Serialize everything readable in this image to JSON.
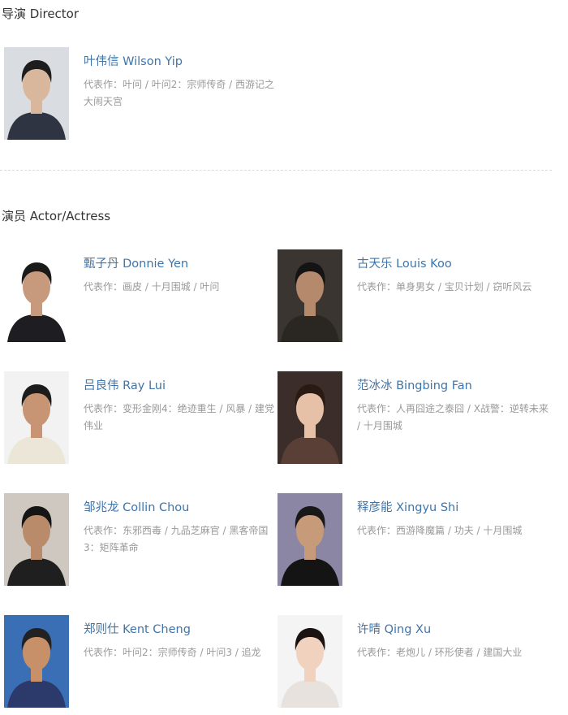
{
  "director_section": {
    "title": "导演 Director",
    "people": [
      {
        "name": "叶伟信 Wilson Yip",
        "label": "代表作：",
        "works": "叶问 / 叶问2：宗师传奇 / 西游记之大闹天宫",
        "photo": {
          "bg": "#d9dde2",
          "face": "#d8b79c",
          "hair": "#1d1d1d",
          "cloth": "#2e3442"
        }
      }
    ]
  },
  "actor_section": {
    "title": "演员 Actor/Actress",
    "people": [
      {
        "name": "甄子丹 Donnie Yen",
        "label": "代表作：",
        "works": "画皮 / 十月围城 / 叶问",
        "photo": {
          "bg": "#ffffff",
          "face": "#c89a7d",
          "hair": "#1a1a1a",
          "cloth": "#1e1e22"
        }
      },
      {
        "name": "古天乐 Louis Koo",
        "label": "代表作：",
        "works": "单身男女 / 宝贝计划 / 窃听风云",
        "photo": {
          "bg": "#3a3530",
          "face": "#b58a6c",
          "hair": "#141414",
          "cloth": "#2a2622"
        }
      },
      {
        "name": "吕良伟 Ray Lui",
        "label": "代表作：",
        "works": "变形金刚4：绝迹重生 / 风暴 / 建党伟业",
        "photo": {
          "bg": "#f2f2f2",
          "face": "#c79474",
          "hair": "#1c1c1c",
          "cloth": "#ece6d8"
        }
      },
      {
        "name": "范冰冰 Bingbing Fan",
        "label": "代表作：",
        "works": "人再囧途之泰囧 / X战警：逆转未来 / 十月围城",
        "photo": {
          "bg": "#3b2e2a",
          "face": "#e6c1a8",
          "hair": "#2a1a14",
          "cloth": "#5a3f36"
        }
      },
      {
        "name": "邹兆龙 Collin Chou",
        "label": "代表作：",
        "works": "东邪西毒 / 九品芝麻官 / 黑客帝国3：矩阵革命",
        "photo": {
          "bg": "#cfc8c0",
          "face": "#b98b6b",
          "hair": "#151515",
          "cloth": "#1f1f1f"
        }
      },
      {
        "name": "释彦能 Xingyu Shi",
        "label": "代表作：",
        "works": "西游降魔篇 / 功夫 / 十月围城",
        "photo": {
          "bg": "#8b86a3",
          "face": "#c79a7a",
          "hair": "#181818",
          "cloth": "#141414"
        }
      },
      {
        "name": "郑则仕 Kent Cheng",
        "label": "代表作：",
        "works": "叶问2：宗师传奇 / 叶问3 / 追龙",
        "photo": {
          "bg": "#3a6fb5",
          "face": "#c79069",
          "hair": "#222222",
          "cloth": "#2b3a6a"
        }
      },
      {
        "name": "许晴 Qing Xu",
        "label": "代表作：",
        "works": "老炮儿 / 环形使者 / 建国大业",
        "photo": {
          "bg": "#f4f4f4",
          "face": "#f0d2bf",
          "hair": "#1b1311",
          "cloth": "#e8e2de"
        }
      }
    ]
  }
}
